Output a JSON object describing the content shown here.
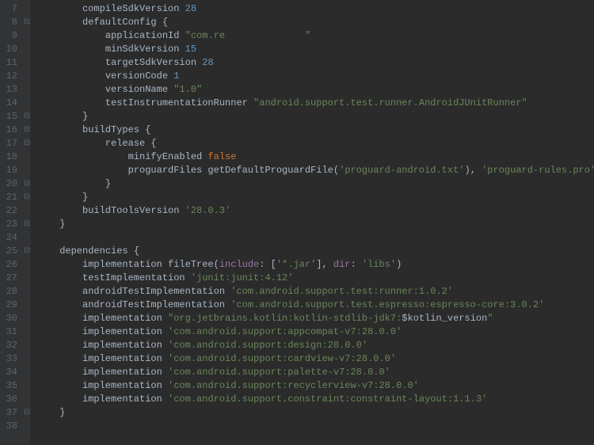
{
  "startLine": 7,
  "lines": [
    {
      "indent": 8,
      "fold": "",
      "tokens": [
        [
          "ident",
          "compileSdkVersion "
        ],
        [
          "num",
          "28"
        ]
      ]
    },
    {
      "indent": 8,
      "fold": "⊟",
      "tokens": [
        [
          "ident",
          "defaultConfig {"
        ]
      ]
    },
    {
      "indent": 12,
      "fold": "",
      "tokens": [
        [
          "ident",
          "applicationId "
        ],
        [
          "str",
          "\"com.re              \""
        ]
      ]
    },
    {
      "indent": 12,
      "fold": "",
      "tokens": [
        [
          "ident",
          "minSdkVersion "
        ],
        [
          "num",
          "15"
        ]
      ]
    },
    {
      "indent": 12,
      "fold": "",
      "tokens": [
        [
          "ident",
          "targetSdkVersion "
        ],
        [
          "num",
          "28"
        ]
      ]
    },
    {
      "indent": 12,
      "fold": "",
      "tokens": [
        [
          "ident",
          "versionCode "
        ],
        [
          "num",
          "1"
        ]
      ]
    },
    {
      "indent": 12,
      "fold": "",
      "tokens": [
        [
          "ident",
          "versionName "
        ],
        [
          "str",
          "\"1.0\""
        ]
      ]
    },
    {
      "indent": 12,
      "fold": "",
      "tokens": [
        [
          "ident",
          "testInstrumentationRunner "
        ],
        [
          "str",
          "\"android.support.test.runner.AndroidJUnitRunner\""
        ]
      ]
    },
    {
      "indent": 8,
      "fold": "⊟",
      "tokens": [
        [
          "ident",
          "}"
        ]
      ]
    },
    {
      "indent": 8,
      "fold": "⊟",
      "tokens": [
        [
          "ident",
          "buildTypes {"
        ]
      ]
    },
    {
      "indent": 12,
      "fold": "⊟",
      "tokens": [
        [
          "ident",
          "release {"
        ]
      ]
    },
    {
      "indent": 16,
      "fold": "",
      "tokens": [
        [
          "ident",
          "minifyEnabled "
        ],
        [
          "kw",
          "false"
        ]
      ]
    },
    {
      "indent": 16,
      "fold": "",
      "tokens": [
        [
          "ident",
          "proguardFiles getDefaultProguardFile("
        ],
        [
          "str",
          "'proguard-android.txt'"
        ],
        [
          "ident",
          "), "
        ],
        [
          "str",
          "'proguard-rules.pro'"
        ]
      ]
    },
    {
      "indent": 12,
      "fold": "⊟",
      "tokens": [
        [
          "ident",
          "}"
        ]
      ]
    },
    {
      "indent": 8,
      "fold": "⊟",
      "tokens": [
        [
          "ident",
          "}"
        ]
      ]
    },
    {
      "indent": 8,
      "fold": "",
      "tokens": [
        [
          "ident",
          "buildToolsVersion "
        ],
        [
          "str",
          "'28.0.3'"
        ]
      ]
    },
    {
      "indent": 4,
      "fold": "⊟",
      "tokens": [
        [
          "ident",
          "}"
        ]
      ]
    },
    {
      "indent": 0,
      "fold": "",
      "tokens": []
    },
    {
      "indent": 4,
      "fold": "⊟",
      "tokens": [
        [
          "ident",
          "dependencies {"
        ]
      ]
    },
    {
      "indent": 8,
      "fold": "",
      "tokens": [
        [
          "ident",
          "implementation fileTree("
        ],
        [
          "named",
          "include"
        ],
        [
          "ident",
          ": ["
        ],
        [
          "str",
          "'*.jar'"
        ],
        [
          "ident",
          "], "
        ],
        [
          "named",
          "dir"
        ],
        [
          "ident",
          ": "
        ],
        [
          "str",
          "'libs'"
        ],
        [
          "ident",
          ")"
        ]
      ]
    },
    {
      "indent": 8,
      "fold": "",
      "tokens": [
        [
          "ident",
          "testImplementation "
        ],
        [
          "str",
          "'junit:junit:4.12'"
        ]
      ]
    },
    {
      "indent": 8,
      "fold": "",
      "tokens": [
        [
          "ident",
          "androidTestImplementation "
        ],
        [
          "str",
          "'com.android.support.test:runner:1.0.2'"
        ]
      ]
    },
    {
      "indent": 8,
      "fold": "",
      "tokens": [
        [
          "ident",
          "androidTestImplementation "
        ],
        [
          "str",
          "'com.android.support.test.espresso:espresso-core:3.0.2'"
        ]
      ]
    },
    {
      "indent": 8,
      "fold": "",
      "tokens": [
        [
          "ident",
          "implementation "
        ],
        [
          "str",
          "\"org.jetbrains.kotlin:kotlin-stdlib-jdk7:"
        ],
        [
          "ident",
          "$kotlin_version"
        ],
        [
          "str",
          "\""
        ]
      ]
    },
    {
      "indent": 8,
      "fold": "",
      "tokens": [
        [
          "ident",
          "implementation "
        ],
        [
          "str",
          "'com.android.support:appcompat-v7:28.0.0'"
        ]
      ]
    },
    {
      "indent": 8,
      "fold": "",
      "tokens": [
        [
          "ident",
          "implementation "
        ],
        [
          "str",
          "'com.android.support:design:28.0.0'"
        ]
      ]
    },
    {
      "indent": 8,
      "fold": "",
      "tokens": [
        [
          "ident",
          "implementation "
        ],
        [
          "str",
          "'com.android.support:cardview-v7:28.0.0'"
        ]
      ]
    },
    {
      "indent": 8,
      "fold": "",
      "tokens": [
        [
          "ident",
          "implementation "
        ],
        [
          "str",
          "'com.android.support:palette-v7:28.0.0'"
        ]
      ]
    },
    {
      "indent": 8,
      "fold": "",
      "tokens": [
        [
          "ident",
          "implementation "
        ],
        [
          "str",
          "'com.android.support:recyclerview-v7:28.0.0'"
        ]
      ]
    },
    {
      "indent": 8,
      "fold": "",
      "tokens": [
        [
          "ident",
          "implementation "
        ],
        [
          "str",
          "'com.android.support.constraint:constraint-layout:1.1.3'"
        ]
      ]
    },
    {
      "indent": 4,
      "fold": "⊟",
      "tokens": [
        [
          "ident",
          "}"
        ]
      ]
    },
    {
      "indent": 0,
      "fold": "",
      "tokens": []
    }
  ]
}
